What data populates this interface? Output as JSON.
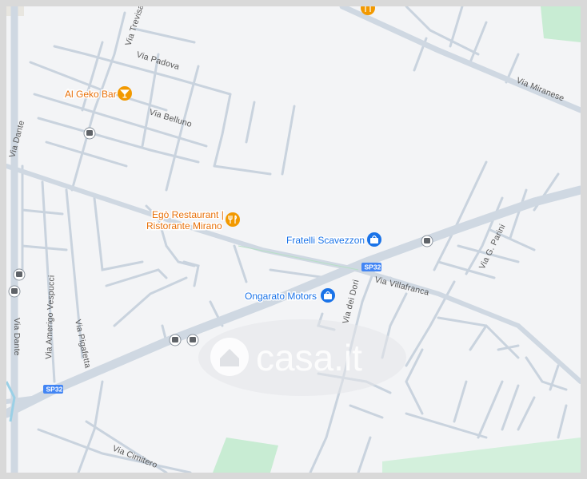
{
  "map": {
    "streets": {
      "via_trevisan": "Via Trevisan",
      "via_padova": "Via Padova",
      "via_belluno": "Via Belluno",
      "via_miranese": "Via Miranese",
      "via_dante_top": "Via Dante",
      "via_dante_left": "Via Dante",
      "via_amerigo_vespucci": "Via Amerigo Vespucci",
      "via_pigafetta": "Via Pigafetta",
      "via_cimitero": "Via Cimitero",
      "via_dei_dori": "Via dei Dori",
      "via_villafranca": "Via Villafranca",
      "via_g_parini": "Via G. Parini"
    },
    "road_shields": {
      "sp32_left": "SP32",
      "sp32_right": "SP32"
    },
    "pois": {
      "al_geko_bar": "Al Geko Bar",
      "ego_restaurant_line1": "Egò Restaurant |",
      "ego_restaurant_line2": "Ristorante Mirano",
      "fratelli_scavezzon": "Fratelli Scavezzon",
      "ongarato_motors": "Ongarato Motors"
    },
    "watermark": "casa.it",
    "colors": {
      "background": "#f3f4f6",
      "road": "#c9d3de",
      "main_road": "#cfd8e2",
      "park": "#c8ecd3",
      "poi_orange": "#e8710a",
      "poi_blue": "#1a73e8",
      "shield": "#4285f4"
    }
  }
}
